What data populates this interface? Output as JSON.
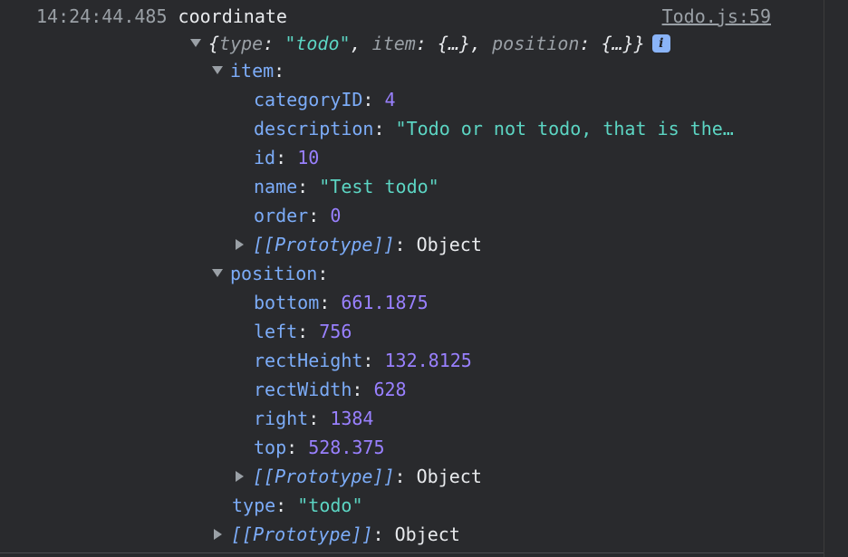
{
  "console": {
    "timestamp": "14:24:44.485",
    "message": "coordinate",
    "source": "Todo.js:59",
    "summary": {
      "open": "{",
      "type_key": "type",
      "type_value": "\"todo\"",
      "item_key": "item",
      "item_value": "{…}",
      "position_key": "position",
      "position_value": "{…}",
      "close": "}",
      "info_icon": "i"
    },
    "item": {
      "label": "item",
      "categoryID_key": "categoryID",
      "categoryID": "4",
      "description_key": "description",
      "description": "\"Todo or not todo, that is the…",
      "id_key": "id",
      "id": "10",
      "name_key": "name",
      "name": "\"Test todo\"",
      "order_key": "order",
      "order": "0",
      "prototype_key": "[[Prototype]]",
      "prototype_value": "Object"
    },
    "position": {
      "label": "position",
      "bottom_key": "bottom",
      "bottom": "661.1875",
      "left_key": "left",
      "left": "756",
      "rectHeight_key": "rectHeight",
      "rectHeight": "132.8125",
      "rectWidth_key": "rectWidth",
      "rectWidth": "628",
      "right_key": "right",
      "right": "1384",
      "top_key": "top",
      "top": "528.375",
      "prototype_key": "[[Prototype]]",
      "prototype_value": "Object"
    },
    "type_key": "type",
    "type_value": "\"todo\"",
    "root_prototype_key": "[[Prototype]]",
    "root_prototype_value": "Object"
  }
}
